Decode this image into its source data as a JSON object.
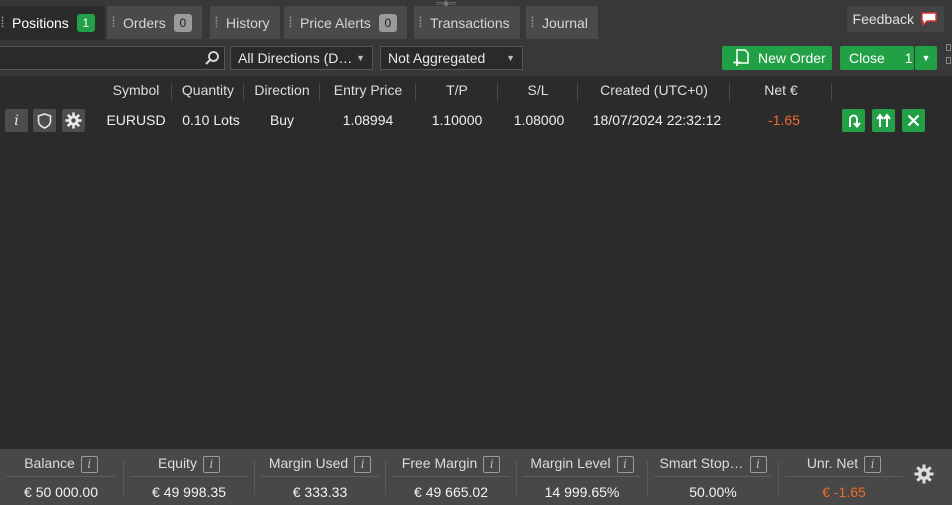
{
  "tabs": [
    {
      "label": "Positions",
      "badge": "1",
      "active": true
    },
    {
      "label": "Orders",
      "badge": "0"
    },
    {
      "label": "History"
    },
    {
      "label": "Price Alerts",
      "badge": "0"
    },
    {
      "label": "Transactions"
    },
    {
      "label": "Journal"
    }
  ],
  "feedback": {
    "label": "Feedback",
    "icon": "chat-bubble-icon"
  },
  "toolbar": {
    "search_placeholder": "",
    "direction_filter": "All Directions (D…",
    "aggregation_filter": "Not Aggregated",
    "new_order_label": "New Order",
    "close_label": "Close",
    "close_count": "1"
  },
  "table": {
    "columns": [
      "Symbol",
      "Quantity",
      "Direction",
      "Entry Price",
      "T/P",
      "S/L",
      "Created (UTC+0)",
      "Net €"
    ],
    "rows": [
      {
        "symbol": "EURUSD",
        "quantity": "0.10 Lots",
        "direction": "Buy",
        "entry_price": "1.08994",
        "tp": "1.10000",
        "sl": "1.08000",
        "created": "18/07/2024 22:32:12",
        "net": "-1.65"
      }
    ]
  },
  "footer": {
    "stats": [
      {
        "label": "Balance",
        "value": "€ 50 000.00"
      },
      {
        "label": "Equity",
        "value": "€ 49 998.35"
      },
      {
        "label": "Margin Used",
        "value": "€ 333.33"
      },
      {
        "label": "Free Margin",
        "value": "€ 49 665.02"
      },
      {
        "label": "Margin Level",
        "value": "14 999.65%"
      },
      {
        "label": "Smart Stop…",
        "value": "50.00%"
      },
      {
        "label": "Unr. Net",
        "value": "€ -1.65"
      }
    ]
  },
  "colors": {
    "accent_green": "#22a045",
    "negative": "#f26a2a",
    "background": "#2b2b2b"
  }
}
